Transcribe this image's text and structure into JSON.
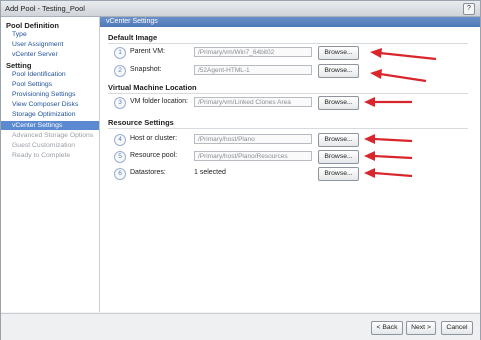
{
  "window": {
    "title": "Add Pool - Testing_Pool",
    "help_label": "?"
  },
  "sidebar": {
    "pool_definition": "Pool Definition",
    "items_def": [
      "Type",
      "User Assignment",
      "vCenter Server"
    ],
    "setting": "Setting",
    "items_set": [
      "Pool Identification",
      "Pool Settings",
      "Provisioning Settings",
      "View Composer Disks",
      "Storage Optimization"
    ],
    "selected": "vCenter Settings",
    "disabled": [
      "Advanced Storage Options",
      "Guest Customization",
      "Ready to Complete"
    ]
  },
  "content": {
    "header": "vCenter Settings",
    "default_image": {
      "heading": "Default Image",
      "parent_vm": {
        "num": "1",
        "label": "Parent VM:",
        "value": "/Primary/vm/Win7_64bit02"
      },
      "snapshot": {
        "num": "2",
        "label": "Snapshot:",
        "value": "/52Agent-HTML-1"
      }
    },
    "vm_location": {
      "heading": "Virtual Machine Location",
      "folder": {
        "num": "3",
        "label": "VM folder location:",
        "value": "/Primary/vm/Linked Clones Area"
      }
    },
    "resource": {
      "heading": "Resource Settings",
      "host": {
        "num": "4",
        "label": "Host or cluster:",
        "value": "/Primary/host/Plano"
      },
      "pool": {
        "num": "5",
        "label": "Resource pool:",
        "value": "/Primary/host/Plano/Resources"
      },
      "datastores": {
        "num": "6",
        "label": "Datastores:",
        "value": "1 selected"
      }
    },
    "browse_label": "Browse...",
    "arrow_color": "#d9262c"
  },
  "footer": {
    "back": "< Back",
    "next": "Next >",
    "cancel": "Cancel"
  }
}
